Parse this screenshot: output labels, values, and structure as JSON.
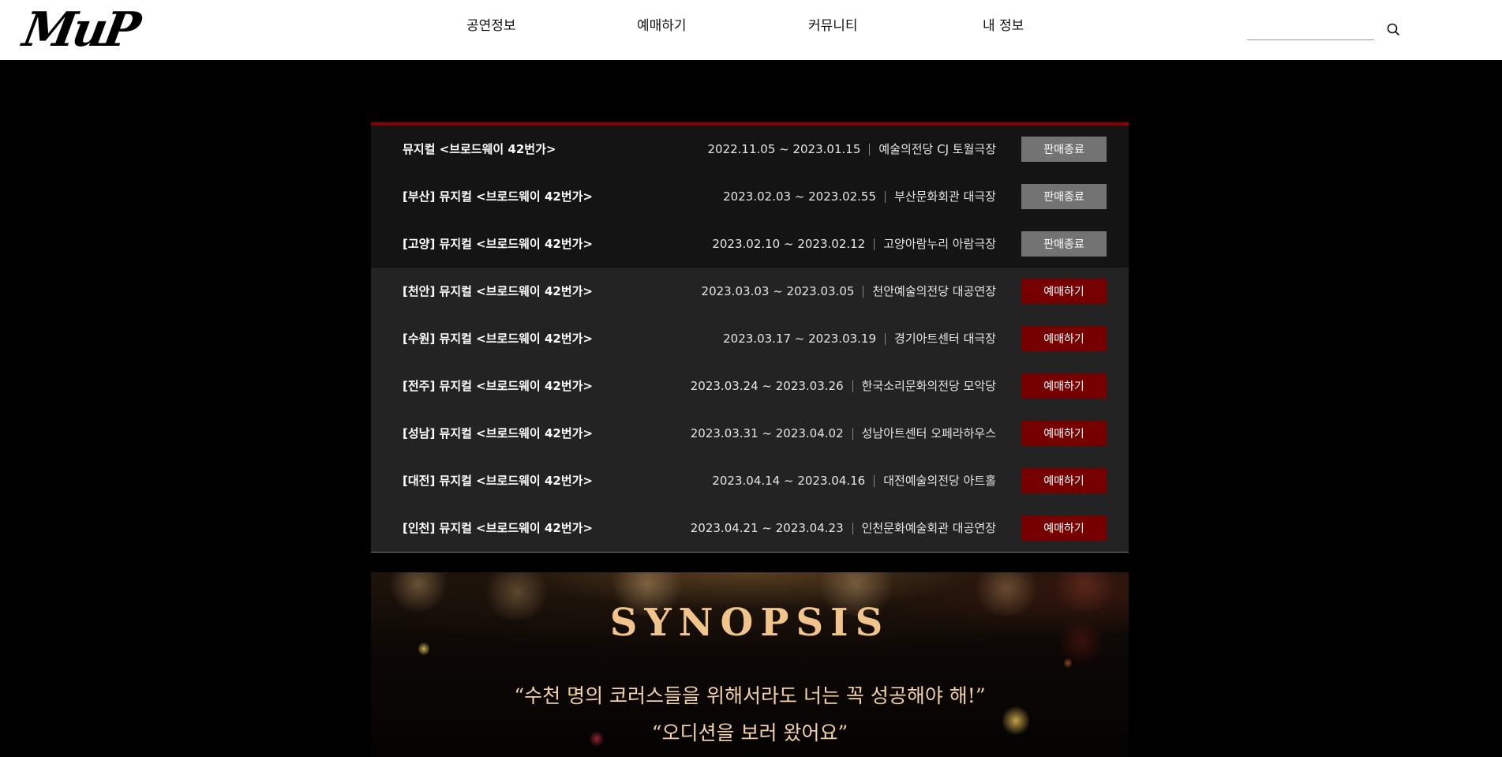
{
  "header": {
    "logo": "MuP",
    "nav": [
      "공연정보",
      "예매하기",
      "커뮤니티",
      "내 정보"
    ],
    "search": {
      "value": "",
      "placeholder": "",
      "icon": "search-icon"
    }
  },
  "schedule": {
    "accent_color": "#8c0000",
    "rows": [
      {
        "title": "뮤지컬 <브로드웨이 42번가>",
        "date": "2022.11.05 ~ 2023.01.15",
        "venue": "예술의전당 CJ 토월극장",
        "button": "판매종료",
        "status": "ended"
      },
      {
        "title": "[부산] 뮤지컬 <브로드웨이 42번가>",
        "date": "2023.02.03 ~ 2023.02.55",
        "venue": "부산문화회관 대극장",
        "button": "판매종료",
        "status": "ended"
      },
      {
        "title": "[고양] 뮤지컬 <브로드웨이 42번가>",
        "date": "2023.02.10 ~ 2023.02.12",
        "venue": "고양아람누리 아람극장",
        "button": "판매종료",
        "status": "ended"
      },
      {
        "title": "[천안] 뮤지컬 <브로드웨이 42번가>",
        "date": "2023.03.03 ~ 2023.03.05",
        "venue": "천안예술의전당 대공연장",
        "button": "예매하기",
        "status": "open"
      },
      {
        "title": "[수원] 뮤지컬 <브로드웨이 42번가>",
        "date": "2023.03.17 ~ 2023.03.19",
        "venue": "경기아트센터 대극장",
        "button": "예매하기",
        "status": "open"
      },
      {
        "title": "[전주] 뮤지컬 <브로드웨이 42번가>",
        "date": "2023.03.24 ~ 2023.03.26",
        "venue": "한국소리문화의전당 모악당",
        "button": "예매하기",
        "status": "open"
      },
      {
        "title": "[성남] 뮤지컬 <브로드웨이 42번가>",
        "date": "2023.03.31 ~ 2023.04.02",
        "venue": "성남아트센터 오페라하우스",
        "button": "예매하기",
        "status": "open"
      },
      {
        "title": "[대전] 뮤지컬 <브로드웨이 42번가>",
        "date": "2023.04.14 ~ 2023.04.16",
        "venue": "대전예술의전당 아트홀",
        "button": "예매하기",
        "status": "open"
      },
      {
        "title": "[인천] 뮤지컬 <브로드웨이 42번가>",
        "date": "2023.04.21 ~ 2023.04.23",
        "venue": "인천문화예술회관 대공연장",
        "button": "예매하기",
        "status": "open"
      }
    ]
  },
  "synopsis": {
    "title": "SYNOPSIS",
    "quotes": [
      "“수천 명의 코러스들을 위해서라도 너는 꼭 성공해야 해!”",
      "“오디션을 보러 왔어요”"
    ]
  }
}
